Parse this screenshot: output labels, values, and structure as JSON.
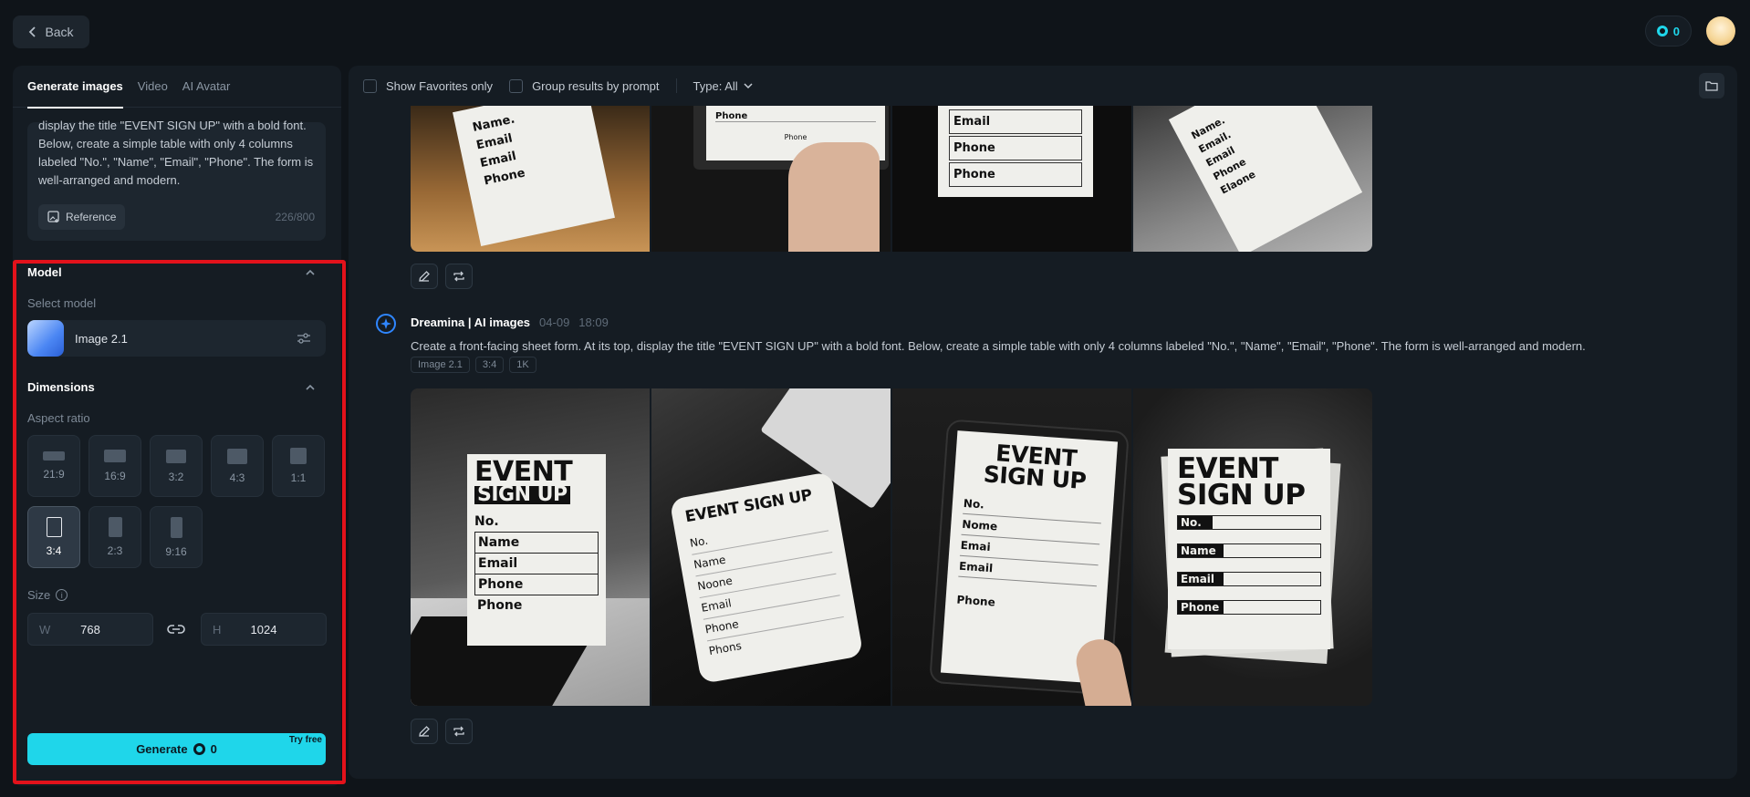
{
  "topbar": {
    "back_label": "Back",
    "credits": "0"
  },
  "left_tabs": [
    {
      "label": "Generate images"
    },
    {
      "label": "Video"
    },
    {
      "label": "AI Avatar"
    }
  ],
  "prompt": {
    "text": "display the title \"EVENT SIGN UP\" with a bold font. Below, create a simple table with only 4 columns labeled \"No.\", \"Name\", \"Email\", \"Phone\". The form is well-arranged and modern.",
    "reference_label": "Reference",
    "char_count": "226/800"
  },
  "model": {
    "section_title": "Model",
    "select_label": "Select model",
    "selected_name": "Image 2.1"
  },
  "dimensions": {
    "section_title": "Dimensions",
    "aspect_label": "Aspect ratio",
    "ratios": [
      "21:9",
      "16:9",
      "3:2",
      "4:3",
      "1:1",
      "3:4",
      "2:3",
      "9:16"
    ],
    "selected_ratio": "3:4",
    "size_label": "Size",
    "width_prefix": "W",
    "width_value": "768",
    "height_prefix": "H",
    "height_value": "1024"
  },
  "generate": {
    "label": "Generate",
    "cost": "0",
    "badge": "Try free"
  },
  "toolbar": {
    "favorites_label": "Show Favorites only",
    "group_label": "Group results by prompt",
    "type_label": "Type: All"
  },
  "generation": {
    "author": "Dreamina | AI images",
    "date": "04-09",
    "time": "18:09",
    "prompt": "Create a front-facing sheet form. At its top, display the title \"EVENT SIGN UP\" with a bold font. Below, create a simple table with only 4 columns labeled \"No.\", \"Name\", \"Email\", \"Phone\". The form is well-arranged and modern.",
    "tags": [
      "Image 2.1",
      "3:4",
      "1K"
    ]
  },
  "sheet": {
    "event": "EVENT",
    "sign_up": "SIGN UP",
    "event_sign_up": "EVENT SIGN UP",
    "fields": [
      "No.",
      "Name",
      "Email",
      "Phone"
    ],
    "alt_fields": [
      "No.",
      "Name",
      "Noone",
      "Email",
      "Phone",
      "Phons"
    ],
    "tablet_fields": [
      "No.",
      "Nome",
      "Emai",
      "Email",
      "Phone"
    ],
    "partial_top": [
      "Name.",
      "Email",
      "Email",
      "Phone"
    ],
    "tablet_partial": [
      "Phone",
      "Phone"
    ],
    "print_partial": [
      "Email",
      "Phone",
      "Phone"
    ],
    "angled_partial": [
      "Name.",
      "Email.",
      "Email",
      "Phone",
      "Elaone"
    ]
  },
  "colors": {
    "accent": "#1fd6ea",
    "highlight": "#e3121b",
    "brand": "#2f86ff"
  }
}
